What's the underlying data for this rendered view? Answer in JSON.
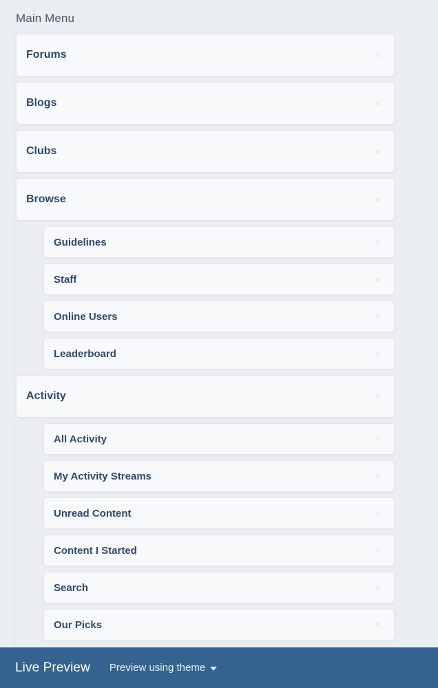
{
  "panel": {
    "title": "Main Menu"
  },
  "icons": {
    "remove": "×",
    "caret": "caret-down-icon"
  },
  "menu": [
    {
      "label": "Forums",
      "children": []
    },
    {
      "label": "Blogs",
      "children": []
    },
    {
      "label": "Clubs",
      "children": []
    },
    {
      "label": "Browse",
      "children": [
        {
          "label": "Guidelines"
        },
        {
          "label": "Staff"
        },
        {
          "label": "Online Users"
        },
        {
          "label": "Leaderboard"
        }
      ]
    },
    {
      "label": "Activity",
      "children": [
        {
          "label": "All Activity"
        },
        {
          "label": "My Activity Streams"
        },
        {
          "label": "Unread Content"
        },
        {
          "label": "Content I Started"
        },
        {
          "label": "Search"
        },
        {
          "label": "Our Picks"
        }
      ]
    }
  ],
  "preview_bar": {
    "title": "Live Preview",
    "theme_label": "Preview using theme"
  },
  "colors": {
    "background": "#eaedf2",
    "card": "#f8f9fa",
    "card_border": "#e3e6ec",
    "label": "#2f4a6d",
    "preview_bar": "#34638f",
    "remove_icon": "#dfe3e9"
  }
}
